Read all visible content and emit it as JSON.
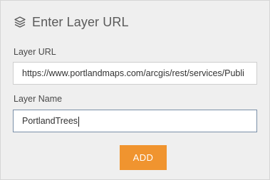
{
  "header": {
    "icon": "layers-icon",
    "title": "Enter Layer URL"
  },
  "form": {
    "url_label": "Layer URL",
    "url_value": "https://www.portlandmaps.com/arcgis/rest/services/Publi",
    "name_label": "Layer Name",
    "name_value": "PortlandTrees"
  },
  "actions": {
    "add_label": "ADD"
  },
  "colors": {
    "panel_bg": "#efefef",
    "accent": "#f0942f",
    "focus_border": "#7a8fa8"
  }
}
